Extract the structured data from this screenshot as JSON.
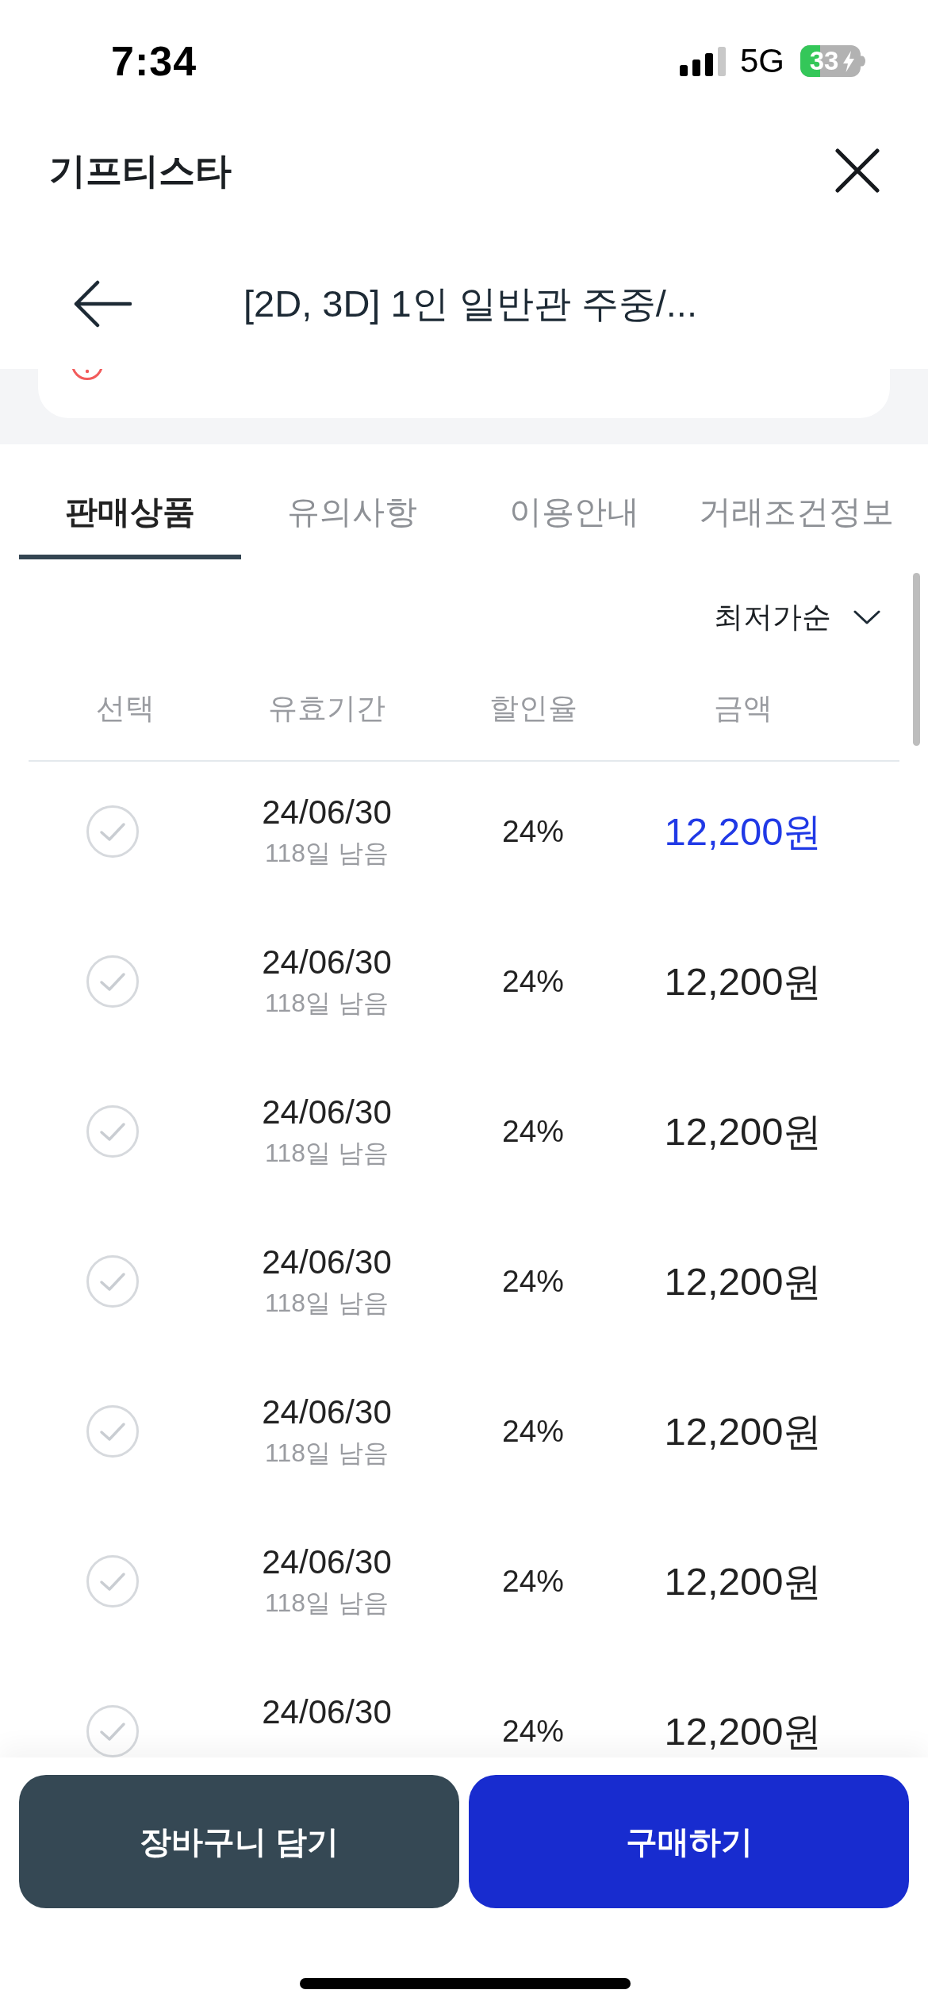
{
  "status_bar": {
    "time": "7:34",
    "network": "5G",
    "battery": "33"
  },
  "header": {
    "title": "기프티스타"
  },
  "nav": {
    "title": "[2D, 3D] 1인 일반관 주중/..."
  },
  "tabs": [
    {
      "label": "판매상품",
      "selected": true
    },
    {
      "label": "유의사항",
      "selected": false
    },
    {
      "label": "이용안내",
      "selected": false
    },
    {
      "label": "거래조건정보",
      "selected": false
    }
  ],
  "sort": {
    "label": "최저가순"
  },
  "table": {
    "columns": [
      "선택",
      "유효기간",
      "할인율",
      "금액"
    ],
    "rows": [
      {
        "checked": false,
        "date": "24/06/30",
        "remaining": "118일 남음",
        "discount": "24%",
        "price": "12,200원",
        "highlighted": true
      },
      {
        "checked": false,
        "date": "24/06/30",
        "remaining": "118일 남음",
        "discount": "24%",
        "price": "12,200원",
        "highlighted": false
      },
      {
        "checked": false,
        "date": "24/06/30",
        "remaining": "118일 남음",
        "discount": "24%",
        "price": "12,200원",
        "highlighted": false
      },
      {
        "checked": false,
        "date": "24/06/30",
        "remaining": "118일 남음",
        "discount": "24%",
        "price": "12,200원",
        "highlighted": false
      },
      {
        "checked": false,
        "date": "24/06/30",
        "remaining": "118일 남음",
        "discount": "24%",
        "price": "12,200원",
        "highlighted": false
      },
      {
        "checked": false,
        "date": "24/06/30",
        "remaining": "118일 남음",
        "discount": "24%",
        "price": "12,200원",
        "highlighted": false
      },
      {
        "checked": false,
        "date": "24/06/30",
        "discount": "24%",
        "price": "12,200원",
        "highlighted": false
      }
    ]
  },
  "buttons": [
    {
      "label": "장바구니 담기",
      "kind": "cart"
    },
    {
      "label": "구매하기",
      "kind": "buy"
    }
  ]
}
